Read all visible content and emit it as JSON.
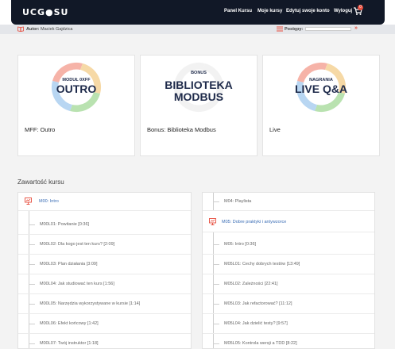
{
  "header": {
    "logo": "UCG●SU",
    "nav": [
      "Panel Kursu",
      "Moje kursy",
      "Edytuj swoje konto",
      "Wyloguj"
    ],
    "cart_count": "0"
  },
  "infobar": {
    "author_label": "Autor:",
    "author_name": "Maciek Gajdzica",
    "progress_label": "Postępy:",
    "progress_fraction": 0,
    "progress_arrow": "»"
  },
  "cards": [
    {
      "kicker": "MODUŁ 0XFF",
      "big": "OUTRO",
      "title": "MFF: Outro",
      "style": "arrows"
    },
    {
      "kicker": "BONUS",
      "big1": "BIBLIOTEKA",
      "big2": "MODBUS",
      "title": "Bonus: Biblioteka Modbus",
      "style": "bonus"
    },
    {
      "kicker": "NAGRANIA",
      "big": "LIVE Q&A",
      "title": "Live",
      "style": "arrows"
    }
  ],
  "content": {
    "section_title": "Zawartość kursu",
    "left_module": "M00: Intro",
    "left_lessons": [
      "M00L01: Powitanie [0:36]",
      "M00L02: Dla kogo jest ten kurs? [2:09]",
      "M00L03: Plan działania [3:09]",
      "M00L04: Jak studiować ten kurs [1:56]",
      "M00L05: Narzędzia wykorzystywane w kursie [1:14]",
      "M00L06: Efekt końcowy [1:42]",
      "M00L07: Twój instruktor [1:18]"
    ],
    "right_top": "M04: Playlista",
    "right_module": "M05: Dobre praktyki i antywzorce",
    "right_lessons": [
      "M05: Intro [0:36]",
      "M05L01: Cechy dobrych testów [13:49]",
      "M05L02: Zależności [22:41]",
      "M05L03: Jak refactorować? [11:12]",
      "M05L04: Jak dzielić testy? [9:57]",
      "M05L05: Kontrola wersji a TDD [8:22]"
    ]
  },
  "colors": {
    "accent": "#e74c3c",
    "nav_bg": "#111827",
    "module_blue": "#3a6db5",
    "title_navy": "#1e2a4a"
  }
}
